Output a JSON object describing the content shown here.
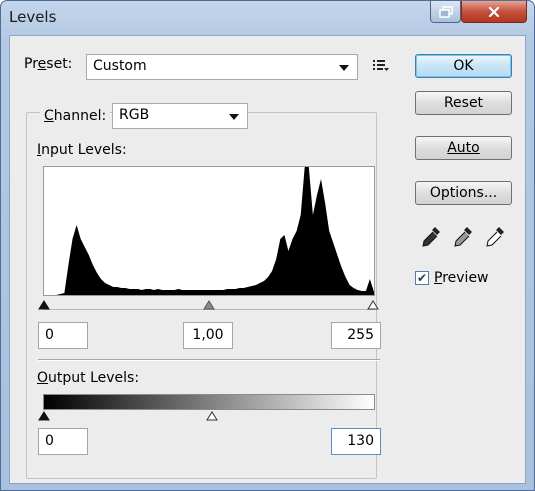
{
  "window": {
    "title": "Levels"
  },
  "preset": {
    "label_pre": "Pr",
    "label_u": "e",
    "label_post": "set:",
    "value": "Custom"
  },
  "channel": {
    "label_u": "C",
    "label_post": "hannel:",
    "value": "RGB"
  },
  "input_levels": {
    "label_u": "I",
    "label_post": "nput Levels:",
    "black": "0",
    "gamma": "1,00",
    "white": "255",
    "histogram_profile": [
      0,
      0,
      0,
      0,
      1,
      2,
      30,
      56,
      70,
      56,
      48,
      40,
      30,
      22,
      16,
      12,
      10,
      8,
      8,
      7,
      7,
      6,
      6,
      6,
      5,
      6,
      6,
      5,
      6,
      5,
      5,
      5,
      5,
      6,
      5,
      5,
      5,
      5,
      5,
      5,
      5,
      5,
      5,
      5,
      5,
      6,
      6,
      6,
      7,
      7,
      8,
      9,
      10,
      12,
      14,
      18,
      24,
      36,
      56,
      60,
      44,
      56,
      64,
      80,
      130,
      128,
      80,
      100,
      116,
      92,
      64,
      52,
      40,
      28,
      18,
      10,
      7,
      5,
      4,
      4,
      16,
      3
    ]
  },
  "output_levels": {
    "label_u": "O",
    "label_post": "utput Levels:",
    "black": "0",
    "white": "130"
  },
  "buttons": {
    "ok": "OK",
    "reset": "Reset",
    "auto": "Auto",
    "options": "Options..."
  },
  "preview": {
    "label_u": "P",
    "label_post": "review",
    "checked": true
  },
  "icons": [
    "restore-icon",
    "close-icon",
    "preset-options-icon",
    "black-eyedropper-icon",
    "gray-eyedropper-icon",
    "white-eyedropper-icon"
  ]
}
